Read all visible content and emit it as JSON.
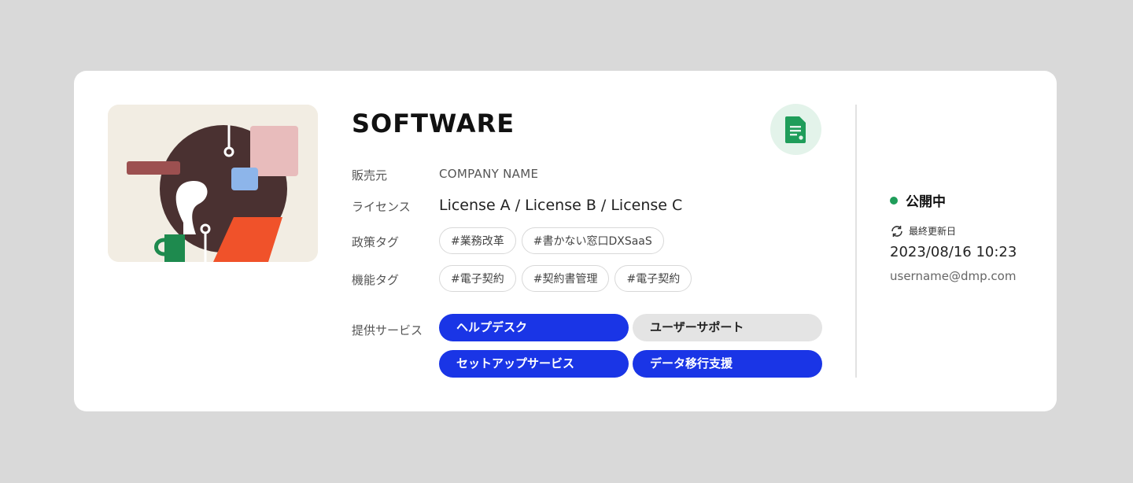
{
  "product": {
    "title": "SOFTWARE",
    "illustration_icon": "workspace-illustration",
    "badge_icon": "document-icon"
  },
  "details": {
    "vendor_label": "販売元",
    "vendor_value": "COMPANY NAME",
    "license_label": "ライセンス",
    "license_value": "License A / License B / License C",
    "policy_tags_label": "政策タグ",
    "policy_tags": [
      "#業務改革",
      "#書かない窓口DXSaaS"
    ],
    "feature_tags_label": "機能タグ",
    "feature_tags": [
      "#電子契約",
      "#契約書管理",
      "#電子契約"
    ],
    "services_label": "提供サービス",
    "services": [
      {
        "label": "ヘルプデスク",
        "active": true
      },
      {
        "label": "ユーザーサポート",
        "active": false
      },
      {
        "label": "セットアップサービス",
        "active": true
      },
      {
        "label": "データ移行支援",
        "active": true
      }
    ]
  },
  "status": {
    "label": "公開中",
    "color": "#1f9d5a",
    "updated_label": "最終更新日",
    "updated_icon": "refresh-icon",
    "updated_at": "2023/08/16 10:23",
    "updated_by": "username@dmp.com"
  },
  "colors": {
    "accent": "#1a35e6",
    "inactive": "#e4e4e4",
    "badge_bg": "#e3f3ea",
    "badge_fg": "#1f9d5a"
  }
}
